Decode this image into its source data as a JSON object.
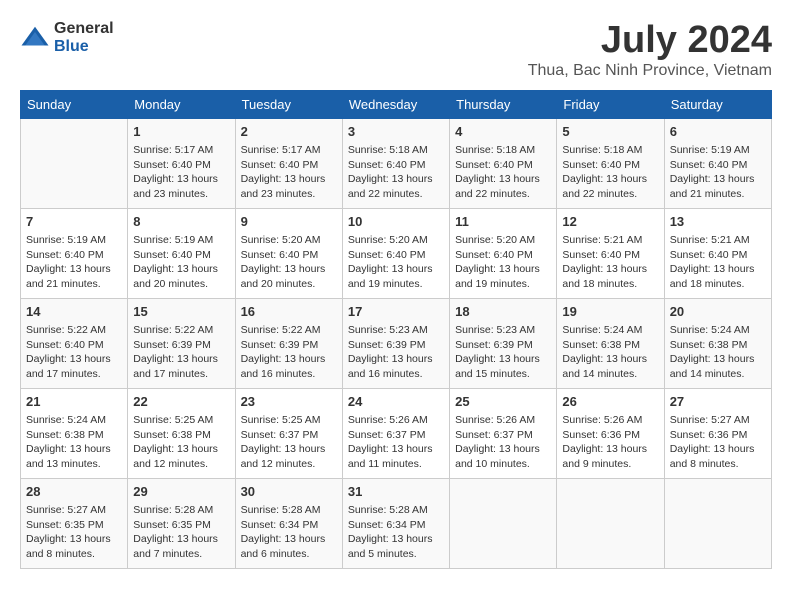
{
  "header": {
    "logo_general": "General",
    "logo_blue": "Blue",
    "month_title": "July 2024",
    "location": "Thua, Bac Ninh Province, Vietnam"
  },
  "days_of_week": [
    "Sunday",
    "Monday",
    "Tuesday",
    "Wednesday",
    "Thursday",
    "Friday",
    "Saturday"
  ],
  "weeks": [
    [
      {
        "day": "",
        "info": ""
      },
      {
        "day": "1",
        "info": "Sunrise: 5:17 AM\nSunset: 6:40 PM\nDaylight: 13 hours\nand 23 minutes."
      },
      {
        "day": "2",
        "info": "Sunrise: 5:17 AM\nSunset: 6:40 PM\nDaylight: 13 hours\nand 23 minutes."
      },
      {
        "day": "3",
        "info": "Sunrise: 5:18 AM\nSunset: 6:40 PM\nDaylight: 13 hours\nand 22 minutes."
      },
      {
        "day": "4",
        "info": "Sunrise: 5:18 AM\nSunset: 6:40 PM\nDaylight: 13 hours\nand 22 minutes."
      },
      {
        "day": "5",
        "info": "Sunrise: 5:18 AM\nSunset: 6:40 PM\nDaylight: 13 hours\nand 22 minutes."
      },
      {
        "day": "6",
        "info": "Sunrise: 5:19 AM\nSunset: 6:40 PM\nDaylight: 13 hours\nand 21 minutes."
      }
    ],
    [
      {
        "day": "7",
        "info": "Sunrise: 5:19 AM\nSunset: 6:40 PM\nDaylight: 13 hours\nand 21 minutes."
      },
      {
        "day": "8",
        "info": "Sunrise: 5:19 AM\nSunset: 6:40 PM\nDaylight: 13 hours\nand 20 minutes."
      },
      {
        "day": "9",
        "info": "Sunrise: 5:20 AM\nSunset: 6:40 PM\nDaylight: 13 hours\nand 20 minutes."
      },
      {
        "day": "10",
        "info": "Sunrise: 5:20 AM\nSunset: 6:40 PM\nDaylight: 13 hours\nand 19 minutes."
      },
      {
        "day": "11",
        "info": "Sunrise: 5:20 AM\nSunset: 6:40 PM\nDaylight: 13 hours\nand 19 minutes."
      },
      {
        "day": "12",
        "info": "Sunrise: 5:21 AM\nSunset: 6:40 PM\nDaylight: 13 hours\nand 18 minutes."
      },
      {
        "day": "13",
        "info": "Sunrise: 5:21 AM\nSunset: 6:40 PM\nDaylight: 13 hours\nand 18 minutes."
      }
    ],
    [
      {
        "day": "14",
        "info": "Sunrise: 5:22 AM\nSunset: 6:40 PM\nDaylight: 13 hours\nand 17 minutes."
      },
      {
        "day": "15",
        "info": "Sunrise: 5:22 AM\nSunset: 6:39 PM\nDaylight: 13 hours\nand 17 minutes."
      },
      {
        "day": "16",
        "info": "Sunrise: 5:22 AM\nSunset: 6:39 PM\nDaylight: 13 hours\nand 16 minutes."
      },
      {
        "day": "17",
        "info": "Sunrise: 5:23 AM\nSunset: 6:39 PM\nDaylight: 13 hours\nand 16 minutes."
      },
      {
        "day": "18",
        "info": "Sunrise: 5:23 AM\nSunset: 6:39 PM\nDaylight: 13 hours\nand 15 minutes."
      },
      {
        "day": "19",
        "info": "Sunrise: 5:24 AM\nSunset: 6:38 PM\nDaylight: 13 hours\nand 14 minutes."
      },
      {
        "day": "20",
        "info": "Sunrise: 5:24 AM\nSunset: 6:38 PM\nDaylight: 13 hours\nand 14 minutes."
      }
    ],
    [
      {
        "day": "21",
        "info": "Sunrise: 5:24 AM\nSunset: 6:38 PM\nDaylight: 13 hours\nand 13 minutes."
      },
      {
        "day": "22",
        "info": "Sunrise: 5:25 AM\nSunset: 6:38 PM\nDaylight: 13 hours\nand 12 minutes."
      },
      {
        "day": "23",
        "info": "Sunrise: 5:25 AM\nSunset: 6:37 PM\nDaylight: 13 hours\nand 12 minutes."
      },
      {
        "day": "24",
        "info": "Sunrise: 5:26 AM\nSunset: 6:37 PM\nDaylight: 13 hours\nand 11 minutes."
      },
      {
        "day": "25",
        "info": "Sunrise: 5:26 AM\nSunset: 6:37 PM\nDaylight: 13 hours\nand 10 minutes."
      },
      {
        "day": "26",
        "info": "Sunrise: 5:26 AM\nSunset: 6:36 PM\nDaylight: 13 hours\nand 9 minutes."
      },
      {
        "day": "27",
        "info": "Sunrise: 5:27 AM\nSunset: 6:36 PM\nDaylight: 13 hours\nand 8 minutes."
      }
    ],
    [
      {
        "day": "28",
        "info": "Sunrise: 5:27 AM\nSunset: 6:35 PM\nDaylight: 13 hours\nand 8 minutes."
      },
      {
        "day": "29",
        "info": "Sunrise: 5:28 AM\nSunset: 6:35 PM\nDaylight: 13 hours\nand 7 minutes."
      },
      {
        "day": "30",
        "info": "Sunrise: 5:28 AM\nSunset: 6:34 PM\nDaylight: 13 hours\nand 6 minutes."
      },
      {
        "day": "31",
        "info": "Sunrise: 5:28 AM\nSunset: 6:34 PM\nDaylight: 13 hours\nand 5 minutes."
      },
      {
        "day": "",
        "info": ""
      },
      {
        "day": "",
        "info": ""
      },
      {
        "day": "",
        "info": ""
      }
    ]
  ]
}
